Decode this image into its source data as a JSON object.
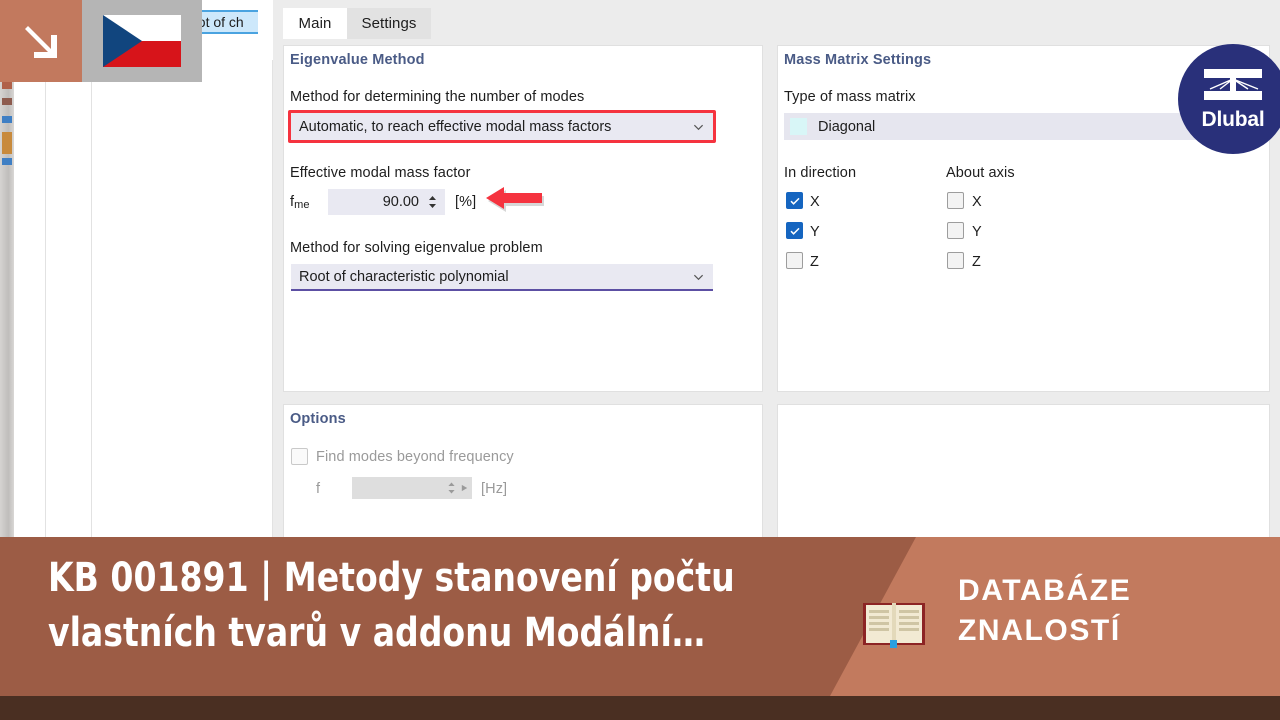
{
  "window": {
    "tabs": [
      {
        "label": "Main",
        "active": true
      },
      {
        "label": "Settings",
        "active": false
      }
    ],
    "background_partial_text": "oot of ch"
  },
  "eigenvalue_method": {
    "section_title": "Eigenvalue Method",
    "method_number_label": "Method for determining the number of modes",
    "method_number_value": "Automatic, to reach effective modal mass factors",
    "effective_factor_label": "Effective modal mass factor",
    "effective_factor_symbol": "f",
    "effective_factor_subscript": "me",
    "effective_factor_value": "90.00",
    "effective_factor_unit": "[%]",
    "solving_label": "Method for solving eigenvalue problem",
    "solving_value": "Root of characteristic polynomial"
  },
  "mass_matrix": {
    "section_title": "Mass Matrix Settings",
    "type_label": "Type of mass matrix",
    "type_value": "Diagonal",
    "in_direction_header": "In direction",
    "about_axis_header": "About axis",
    "in_direction": [
      {
        "label": "X",
        "checked": true
      },
      {
        "label": "Y",
        "checked": true
      },
      {
        "label": "Z",
        "checked": false
      }
    ],
    "about_axis": [
      {
        "label": "X",
        "checked": false
      },
      {
        "label": "Y",
        "checked": false
      },
      {
        "label": "Z",
        "checked": false
      }
    ]
  },
  "options": {
    "section_title": "Options",
    "find_modes_label": "Find modes beyond frequency",
    "find_modes_checked": false,
    "frequency_symbol": "f",
    "frequency_value": "",
    "frequency_unit": "[Hz]"
  },
  "logo": {
    "brand": "Dlubal"
  },
  "banner": {
    "title": "KB 001891 | Metody stanovení počtu vlastních tvarů v addonu Modální…",
    "right_line1": "DATABÁZE",
    "right_line2": "ZNALOSTÍ",
    "book_icon": "open-book-icon"
  },
  "colors": {
    "accent_red": "#f5333f",
    "section_title": "#4a5b86",
    "checkbox_on": "#1565c0",
    "banner_dark": "#9c5c45",
    "banner_light": "#c27a5e",
    "banner_strip": "#4a2f22",
    "logo_navy": "#29307a",
    "combo_bg": "#e9e9f2",
    "focus_underline": "#5c4fa3"
  }
}
